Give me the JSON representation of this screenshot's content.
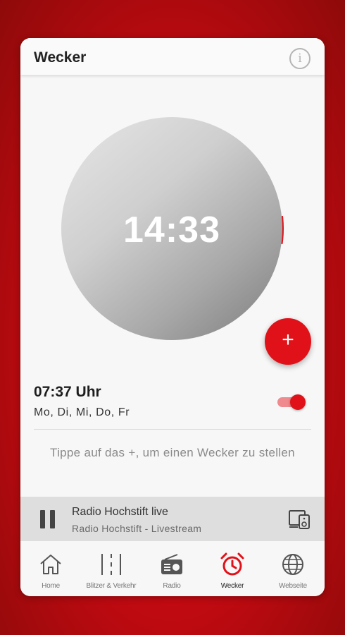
{
  "header": {
    "title": "Wecker",
    "info_icon": "info-icon"
  },
  "clock": {
    "time": "14:33"
  },
  "add_button": {
    "label": "+"
  },
  "alarm": {
    "time": "07:37 Uhr",
    "days": "Mo, Di, Mi, Do, Fr",
    "enabled": true
  },
  "hint": "Tippe auf das +, um einen Wecker zu stellen",
  "player": {
    "title": "Radio Hochstift live",
    "subtitle": "Radio Hochstift - Livestream",
    "state": "playing"
  },
  "nav": {
    "items": [
      {
        "label": "Home",
        "icon": "home-icon"
      },
      {
        "label": "Blitzer & Verkehr",
        "icon": "road-icon"
      },
      {
        "label": "Radio",
        "icon": "radio-icon"
      },
      {
        "label": "Wecker",
        "icon": "alarm-clock-icon",
        "active": true
      },
      {
        "label": "Webseite",
        "icon": "globe-icon"
      }
    ]
  },
  "colors": {
    "accent": "#e01119",
    "background": "#c80a12",
    "card": "#f7f7f7",
    "player_bar": "#dedede"
  }
}
